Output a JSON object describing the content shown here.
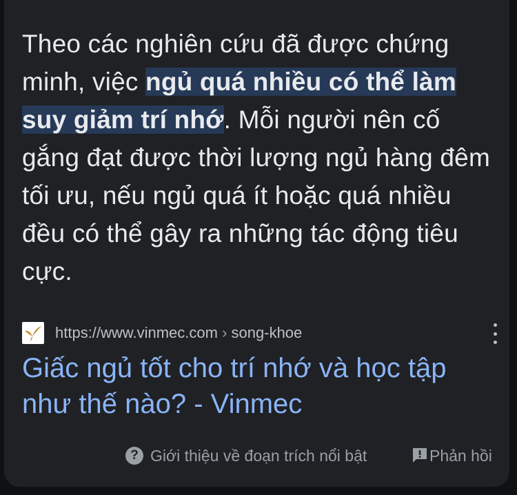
{
  "snippet": {
    "before": "Theo các nghiên cứu đã được chứng minh, việc ",
    "highlight": "ngủ quá nhiều có thể làm suy giảm trí nhớ",
    "after": ". Mỗi người nên cố gắng đạt được thời lượng ngủ hàng đêm tối ưu, nếu ngủ quá ít hoặc quá nhiều đều có thể gây ra những tác động tiêu cực."
  },
  "source": {
    "url": "https://www.vinmec.com",
    "separator": "›",
    "path": "song-khoe",
    "favicon": "vinmec-bird-logo"
  },
  "result": {
    "title": "Giấc ngủ tốt cho trí nhớ và học tập như thế nào? - Vinmec"
  },
  "footer": {
    "about_icon": "help-circle-icon",
    "about_label": "Giới thiệu về đoạn trích nổi bật",
    "feedback_icon": "feedback-icon",
    "feedback_label": "Phản hồi"
  },
  "colors": {
    "background": "#202124",
    "text": "#e8eaed",
    "highlight_bg": "#263957",
    "link": "#8ab4f8",
    "muted": "#9aa0a6"
  }
}
